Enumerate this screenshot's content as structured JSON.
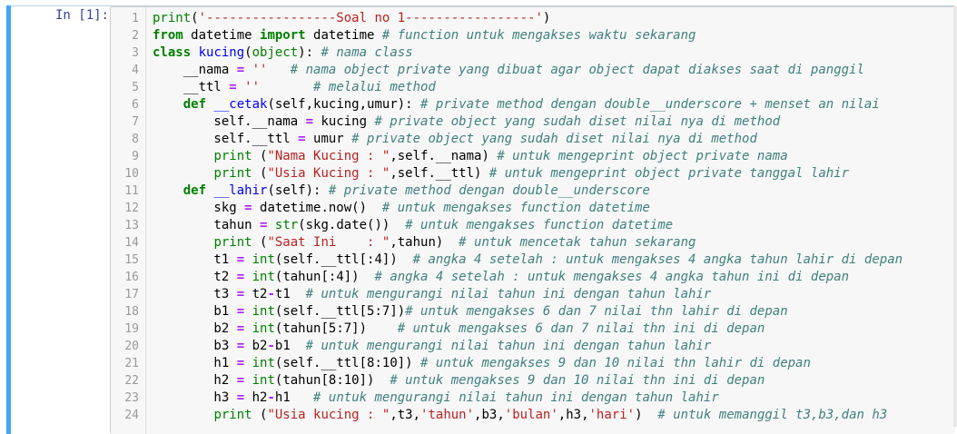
{
  "prompt": "In [1]:",
  "lines": [
    {
      "n": "1",
      "t": [
        [
          "bi",
          "print"
        ],
        [
          "",
          "("
        ],
        [
          "st",
          "'-----------------Soal no 1-----------------'"
        ],
        [
          "",
          ")"
        ]
      ]
    },
    {
      "n": "2",
      "t": [
        [
          "kw",
          "from"
        ],
        [
          "",
          " datetime "
        ],
        [
          "kw",
          "import"
        ],
        [
          "",
          " datetime "
        ],
        [
          "cm",
          "# function untuk mengakses waktu sekarang"
        ]
      ]
    },
    {
      "n": "3",
      "t": [
        [
          "kw",
          "class"
        ],
        [
          "",
          " "
        ],
        [
          "fn",
          "kucing"
        ],
        [
          "",
          "("
        ],
        [
          "bi",
          "object"
        ],
        [
          "",
          "): "
        ],
        [
          "cm",
          "# nama class"
        ]
      ]
    },
    {
      "n": "4",
      "t": [
        [
          "",
          "    __nama "
        ],
        [
          "op",
          "="
        ],
        [
          "",
          " "
        ],
        [
          "st",
          "''"
        ],
        [
          "",
          "   "
        ],
        [
          "cm",
          "# nama object private yang dibuat agar object dapat diakses saat di panggil"
        ]
      ]
    },
    {
      "n": "5",
      "t": [
        [
          "",
          "    __ttl "
        ],
        [
          "op",
          "="
        ],
        [
          "",
          " "
        ],
        [
          "st",
          "''"
        ],
        [
          "",
          "       "
        ],
        [
          "cm",
          "# melalui method"
        ]
      ]
    },
    {
      "n": "6",
      "t": [
        [
          "",
          "    "
        ],
        [
          "kw",
          "def"
        ],
        [
          "",
          " "
        ],
        [
          "fn",
          "__cetak"
        ],
        [
          "",
          "(self,kucing,umur): "
        ],
        [
          "cm",
          "# private method dengan double__underscore + menset an nilai"
        ]
      ]
    },
    {
      "n": "7",
      "t": [
        [
          "",
          "        self.__nama "
        ],
        [
          "op",
          "="
        ],
        [
          "",
          " kucing "
        ],
        [
          "cm",
          "# private object yang sudah diset nilai nya di method"
        ]
      ]
    },
    {
      "n": "8",
      "t": [
        [
          "",
          "        self.__ttl "
        ],
        [
          "op",
          "="
        ],
        [
          "",
          " umur "
        ],
        [
          "cm",
          "# private object yang sudah diset nilai nya di method"
        ]
      ]
    },
    {
      "n": "9",
      "t": [
        [
          "",
          "        "
        ],
        [
          "bi",
          "print"
        ],
        [
          "",
          " ("
        ],
        [
          "st",
          "\"Nama Kucing : \""
        ],
        [
          "",
          ",self.__nama) "
        ],
        [
          "cm",
          "# untuk mengeprint object private nama"
        ]
      ]
    },
    {
      "n": "10",
      "t": [
        [
          "",
          "        "
        ],
        [
          "bi",
          "print"
        ],
        [
          "",
          " ("
        ],
        [
          "st",
          "\"Usia Kucing : \""
        ],
        [
          "",
          ",self.__ttl) "
        ],
        [
          "cm",
          "# untuk mengeprint object private tanggal lahir"
        ]
      ]
    },
    {
      "n": "11",
      "t": [
        [
          "",
          "    "
        ],
        [
          "kw",
          "def"
        ],
        [
          "",
          " "
        ],
        [
          "fn",
          "__lahir"
        ],
        [
          "",
          "(self): "
        ],
        [
          "cm",
          "# private method dengan double__underscore"
        ]
      ]
    },
    {
      "n": "12",
      "t": [
        [
          "",
          "        skg "
        ],
        [
          "op",
          "="
        ],
        [
          "",
          " datetime.now()  "
        ],
        [
          "cm",
          "# untuk mengakses function datetime"
        ]
      ]
    },
    {
      "n": "13",
      "t": [
        [
          "",
          "        tahun "
        ],
        [
          "op",
          "="
        ],
        [
          "",
          " "
        ],
        [
          "bi",
          "str"
        ],
        [
          "",
          "(skg.date())  "
        ],
        [
          "cm",
          "# untuk mengakses function datetime"
        ]
      ]
    },
    {
      "n": "14",
      "t": [
        [
          "",
          "        "
        ],
        [
          "bi",
          "print"
        ],
        [
          "",
          " ("
        ],
        [
          "st",
          "\"Saat Ini    : \""
        ],
        [
          "",
          ",tahun)  "
        ],
        [
          "cm",
          "# untuk mencetak tahun sekarang"
        ]
      ]
    },
    {
      "n": "15",
      "t": [
        [
          "",
          "        t1 "
        ],
        [
          "op",
          "="
        ],
        [
          "",
          " "
        ],
        [
          "bi",
          "int"
        ],
        [
          "",
          "(self.__ttl[:4])  "
        ],
        [
          "cm",
          "# angka 4 setelah : untuk mengakses 4 angka tahun lahir di depan"
        ]
      ]
    },
    {
      "n": "16",
      "t": [
        [
          "",
          "        t2 "
        ],
        [
          "op",
          "="
        ],
        [
          "",
          " "
        ],
        [
          "bi",
          "int"
        ],
        [
          "",
          "(tahun[:4])  "
        ],
        [
          "cm",
          "# angka 4 setelah : untuk mengakses 4 angka tahun ini di depan"
        ]
      ]
    },
    {
      "n": "17",
      "t": [
        [
          "",
          "        t3 "
        ],
        [
          "op",
          "="
        ],
        [
          "",
          " t2"
        ],
        [
          "op",
          "-"
        ],
        [
          "",
          "t1  "
        ],
        [
          "cm",
          "# untuk mengurangi nilai tahun ini dengan tahun lahir"
        ]
      ]
    },
    {
      "n": "18",
      "t": [
        [
          "",
          "        b1 "
        ],
        [
          "op",
          "="
        ],
        [
          "",
          " "
        ],
        [
          "bi",
          "int"
        ],
        [
          "",
          "(self.__ttl[5:7])"
        ],
        [
          "cm",
          "# untuk mengakses 6 dan 7 nilai thn lahir di depan"
        ]
      ]
    },
    {
      "n": "19",
      "t": [
        [
          "",
          "        b2 "
        ],
        [
          "op",
          "="
        ],
        [
          "",
          " "
        ],
        [
          "bi",
          "int"
        ],
        [
          "",
          "(tahun[5:7])    "
        ],
        [
          "cm",
          "# untuk mengakses 6 dan 7 nilai thn ini di depan"
        ]
      ]
    },
    {
      "n": "20",
      "t": [
        [
          "",
          "        b3 "
        ],
        [
          "op",
          "="
        ],
        [
          "",
          " b2"
        ],
        [
          "op",
          "-"
        ],
        [
          "",
          "b1  "
        ],
        [
          "cm",
          "# untuk mengurangi nilai tahun ini dengan tahun lahir"
        ]
      ]
    },
    {
      "n": "21",
      "t": [
        [
          "",
          "        h1 "
        ],
        [
          "op",
          "="
        ],
        [
          "",
          " "
        ],
        [
          "bi",
          "int"
        ],
        [
          "",
          "(self.__ttl[8:10]) "
        ],
        [
          "cm",
          "# untuk mengakses 9 dan 10 nilai thn lahir di depan"
        ]
      ]
    },
    {
      "n": "22",
      "t": [
        [
          "",
          "        h2 "
        ],
        [
          "op",
          "="
        ],
        [
          "",
          " "
        ],
        [
          "bi",
          "int"
        ],
        [
          "",
          "(tahun[8:10])  "
        ],
        [
          "cm",
          "# untuk mengakses 9 dan 10 nilai thn ini di depan"
        ]
      ]
    },
    {
      "n": "23",
      "t": [
        [
          "",
          "        h3 "
        ],
        [
          "op",
          "="
        ],
        [
          "",
          " h2"
        ],
        [
          "op",
          "-"
        ],
        [
          "",
          "h1   "
        ],
        [
          "cm",
          "# untuk mengurangi nilai tahun ini dengan tahun lahir"
        ]
      ]
    },
    {
      "n": "24",
      "t": [
        [
          "",
          "        "
        ],
        [
          "bi",
          "print"
        ],
        [
          "",
          " ("
        ],
        [
          "st",
          "\"Usia kucing : \""
        ],
        [
          "",
          ",t3,"
        ],
        [
          "st",
          "'tahun'"
        ],
        [
          "",
          ",b3,"
        ],
        [
          "st",
          "'bulan'"
        ],
        [
          "",
          ",h3,"
        ],
        [
          "st",
          "'hari'"
        ],
        [
          "",
          ")  "
        ],
        [
          "cm",
          "# untuk memanggil t3,b3,dan h3"
        ]
      ]
    }
  ]
}
